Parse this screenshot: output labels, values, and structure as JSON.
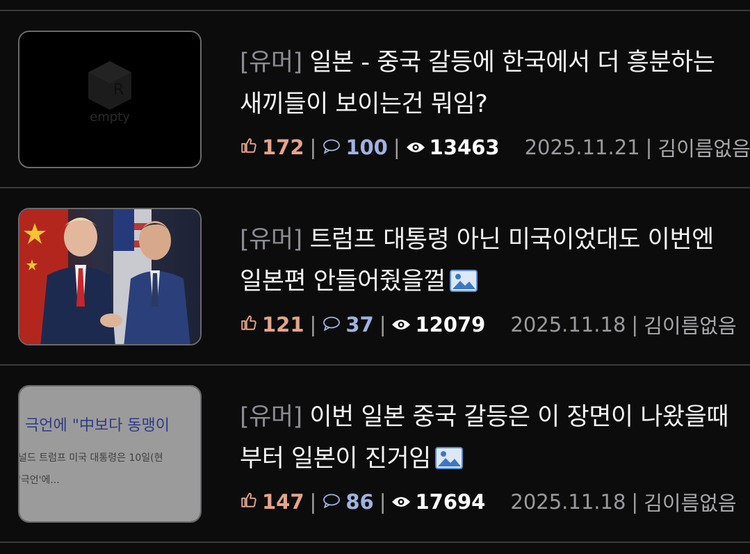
{
  "posts": [
    {
      "category": "[유머]",
      "title": "일본 - 중국 갈등에 한국에서 더 흥분하는 새끼들이 보이는건 뭐임?",
      "has_image_icon": false,
      "thumbnail": {
        "type": "empty",
        "label": "empty"
      },
      "likes": "172",
      "comments": "100",
      "views": "13463",
      "date": "2025.11.21",
      "author": "김이름없음"
    },
    {
      "category": "[유머]",
      "title": "트럼프 대통령 아닌 미국이었대도 이번엔 일본편 안들어줬을껄",
      "has_image_icon": true,
      "thumbnail": {
        "type": "photo",
        "label": ""
      },
      "likes": "121",
      "comments": "37",
      "views": "12079",
      "date": "2025.11.18",
      "author": "김이름없음"
    },
    {
      "category": "[유머]",
      "title": "이번 일본 중국 갈등은 이 장면이 나왔을때부터 일본이 진거임",
      "has_image_icon": true,
      "thumbnail": {
        "type": "news",
        "headline": "극언에 \"中보다 동맹이",
        "line1": "널드 트럼프 미국 대통령은 10일(현",
        "line2": "'극언'에..."
      },
      "likes": "147",
      "comments": "86",
      "views": "17694",
      "date": "2025.11.18",
      "author": "김이름없음"
    }
  ],
  "colors": {
    "like": "#e6a488",
    "comment": "#9fb3df",
    "category": "#8c8c93",
    "background": "#0c0c0d"
  },
  "icons": [
    "thumbs-up-icon",
    "comment-bubble-icon",
    "eye-icon",
    "image-icon"
  ]
}
